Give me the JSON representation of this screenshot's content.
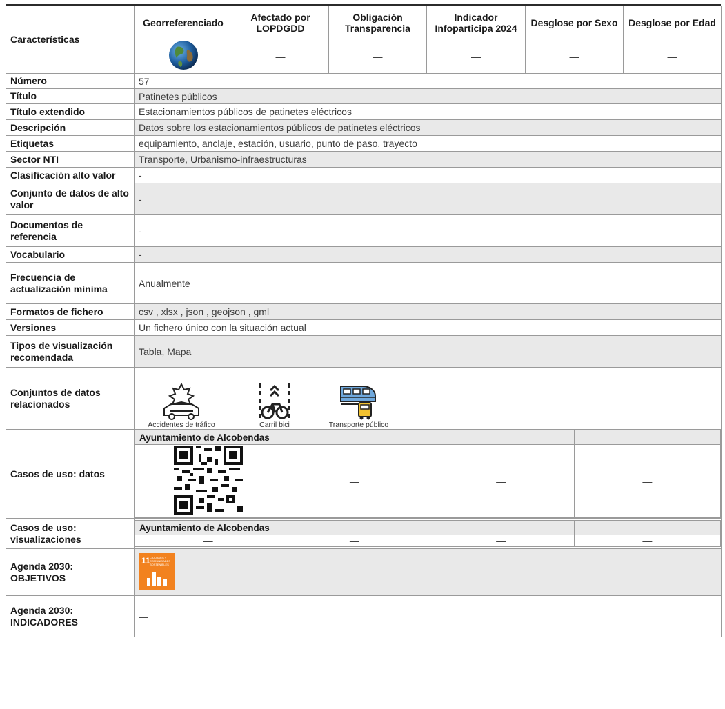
{
  "header": {
    "characteristics_label": "Características",
    "columns": [
      "Georreferenciado",
      "Afectado por LOPDGDD",
      "Obligación Transparencia",
      "Indicador Infoparticipa 2024",
      "Desglose por Sexo",
      "Desglose por Edad"
    ],
    "values": [
      "—",
      "—",
      "—",
      "—",
      "—"
    ],
    "geo_icon": "globe-icon"
  },
  "rows": [
    {
      "label": "Número",
      "value": "57"
    },
    {
      "label": "Título",
      "value": "Patinetes públicos"
    },
    {
      "label": "Título extendido",
      "value": "Estacionamientos públicos de patinetes eléctricos"
    },
    {
      "label": "Descripción",
      "value": "Datos sobre los estacionamientos públicos de patinetes eléctricos"
    },
    {
      "label": "Etiquetas",
      "value": "equipamiento, anclaje, estación, usuario, punto de paso, trayecto"
    },
    {
      "label": "Sector NTI",
      "value": "Transporte, Urbanismo-infraestructuras"
    },
    {
      "label": "Clasificación alto valor",
      "value": "-"
    },
    {
      "label": "Conjunto de datos de alto valor",
      "value": "-"
    },
    {
      "label": "Documentos de referencia",
      "value": "-"
    },
    {
      "label": "Vocabulario",
      "value": "-"
    },
    {
      "label": "Frecuencia de actualización mínima",
      "value": "Anualmente"
    },
    {
      "label": "Formatos de fichero",
      "value": "csv , xlsx , json , geojson , gml"
    },
    {
      "label": "Versiones",
      "value": "Un fichero único con la situación actual"
    },
    {
      "label": "Tipos de visualización recomendada",
      "value": "Tabla, Mapa"
    }
  ],
  "related": {
    "label": "Conjuntos de datos relacionados",
    "items": [
      {
        "name": "Accidentes de tráfico",
        "icon": "car-accident-icon"
      },
      {
        "name": "Carril bici",
        "icon": "bike-lane-icon"
      },
      {
        "name": "Transporte público",
        "icon": "public-transport-icon"
      }
    ]
  },
  "use_cases_data": {
    "label": "Casos de uso: datos",
    "provider": "Ayuntamiento de Alcobendas",
    "qr_icon": "qr-code-icon",
    "others": [
      "—",
      "—",
      "—"
    ]
  },
  "use_cases_viz": {
    "label": "Casos de uso: visualizaciones",
    "provider": "Ayuntamiento de Alcobendas",
    "values": [
      "—",
      "—",
      "—",
      "—"
    ]
  },
  "agenda_objectives": {
    "label": "Agenda 2030: OBJETIVOS",
    "sdg_number": "11",
    "sdg_text": "CIUDADES Y COMUNIDADES SOSTENIBLES",
    "sdg_color": "#f2821f"
  },
  "agenda_indicators": {
    "label": "Agenda 2030: INDICADORES",
    "value": "—"
  }
}
